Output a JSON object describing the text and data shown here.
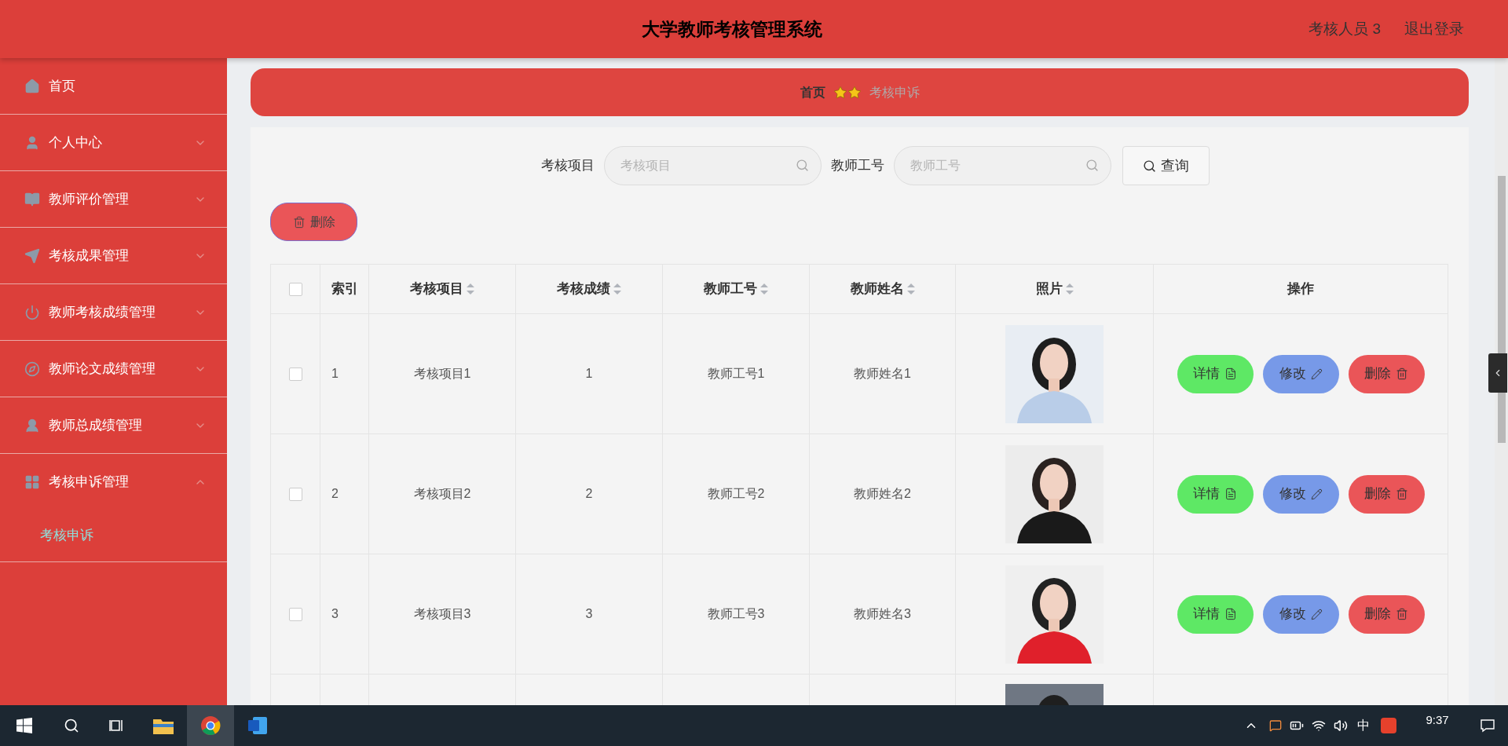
{
  "header": {
    "title": "大学教师考核管理系统",
    "user": "考核人员 3",
    "logout": "退出登录"
  },
  "sidebar": {
    "items": [
      {
        "label": "首页",
        "kind": "link"
      },
      {
        "label": "个人中心",
        "kind": "submenu",
        "expanded": false
      },
      {
        "label": "教师评价管理",
        "kind": "submenu",
        "expanded": false
      },
      {
        "label": "考核成果管理",
        "kind": "submenu",
        "expanded": false
      },
      {
        "label": "教师考核成绩管理",
        "kind": "submenu",
        "expanded": false
      },
      {
        "label": "教师论文成绩管理",
        "kind": "submenu",
        "expanded": false
      },
      {
        "label": "教师总成绩管理",
        "kind": "submenu",
        "expanded": false
      },
      {
        "label": "考核申诉管理",
        "kind": "submenu",
        "expanded": true,
        "children": [
          {
            "label": "考核申诉",
            "selected": true
          }
        ]
      }
    ]
  },
  "breadcrumb": {
    "home": "首页",
    "current": "考核申诉"
  },
  "search": {
    "fields": [
      {
        "label": "考核项目",
        "placeholder": "考核项目"
      },
      {
        "label": "教师工号",
        "placeholder": "教师工号"
      }
    ],
    "button": "查询"
  },
  "delete_button": "删除",
  "table": {
    "all_checked": false,
    "columns": [
      {
        "label": "索引",
        "sortable": false
      },
      {
        "label": "考核项目",
        "sortable": true
      },
      {
        "label": "考核成绩",
        "sortable": true
      },
      {
        "label": "教师工号",
        "sortable": true
      },
      {
        "label": "教师姓名",
        "sortable": true
      },
      {
        "label": "照片",
        "sortable": true
      },
      {
        "label": "操作",
        "sortable": false
      }
    ],
    "rows": [
      {
        "checked": false,
        "index": "1",
        "item": "考核项目1",
        "score": "1",
        "teacher_id": "教师工号1",
        "teacher_name": "教师姓名1",
        "actions": [
          {
            "label": "详情",
            "kind": "detail"
          },
          {
            "label": "修改",
            "kind": "edit"
          },
          {
            "label": "删除",
            "kind": "delete"
          }
        ]
      },
      {
        "checked": false,
        "index": "2",
        "item": "考核项目2",
        "score": "2",
        "teacher_id": "教师工号2",
        "teacher_name": "教师姓名2",
        "actions": [
          {
            "label": "详情",
            "kind": "detail"
          },
          {
            "label": "修改",
            "kind": "edit"
          },
          {
            "label": "删除",
            "kind": "delete"
          }
        ]
      },
      {
        "checked": false,
        "index": "3",
        "item": "考核项目3",
        "score": "3",
        "teacher_id": "教师工号3",
        "teacher_name": "教师姓名3",
        "actions": [
          {
            "label": "详情",
            "kind": "detail"
          },
          {
            "label": "修改",
            "kind": "edit"
          },
          {
            "label": "删除",
            "kind": "delete"
          }
        ]
      }
    ]
  },
  "taskbar": {
    "ime": "中",
    "time": "9:37"
  }
}
